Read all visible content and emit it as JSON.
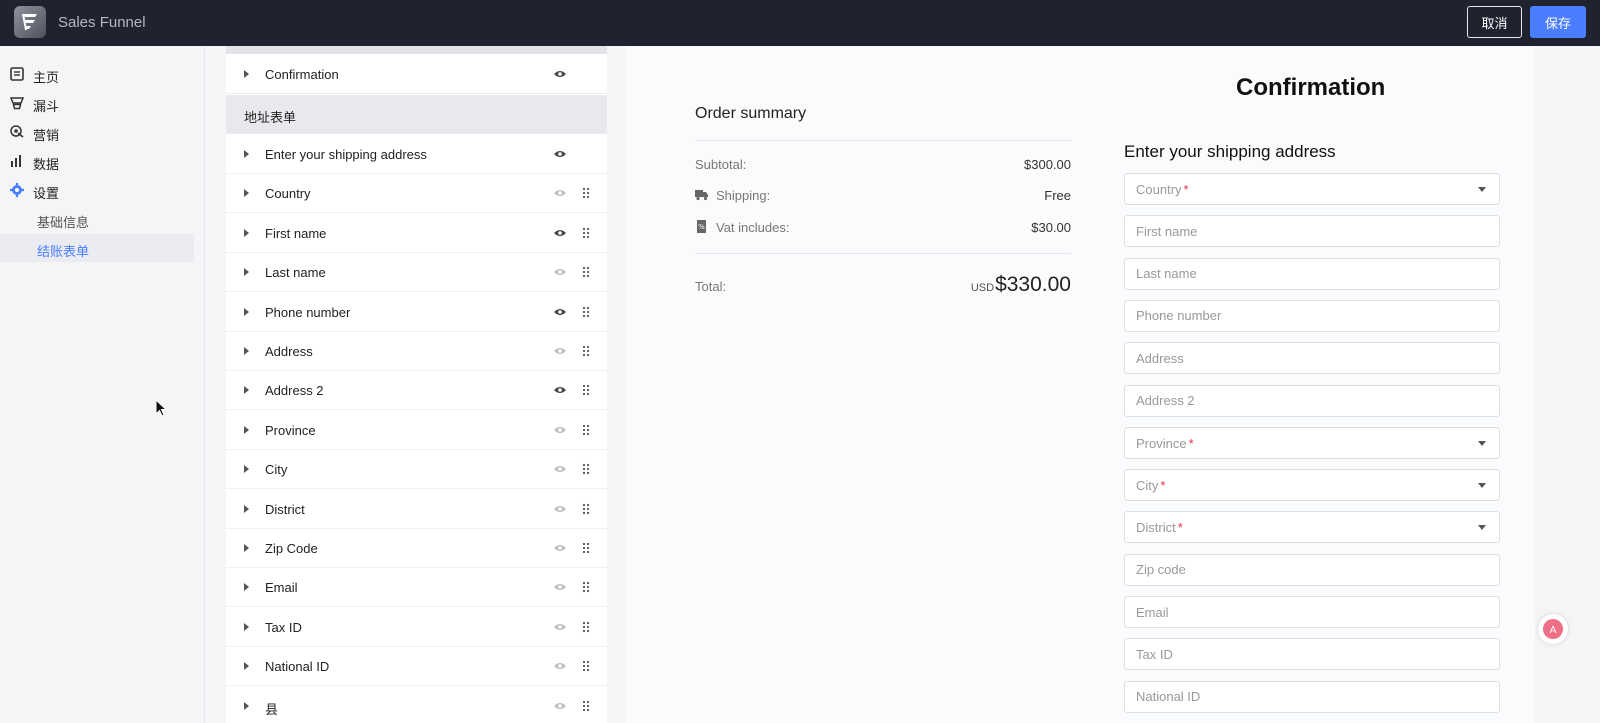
{
  "header": {
    "app_title": "Sales Funnel",
    "cancel_label": "取消",
    "save_label": "保存"
  },
  "sidebar": {
    "items": [
      {
        "label": "主页",
        "icon": "list-icon"
      },
      {
        "label": "漏斗",
        "icon": "funnel-icon"
      },
      {
        "label": "营销",
        "icon": "marketing-icon"
      },
      {
        "label": "数据",
        "icon": "chart-icon"
      },
      {
        "label": "设置",
        "icon": "gear-icon"
      }
    ],
    "sub_items": [
      {
        "label": "基础信息"
      },
      {
        "label": "结账表单",
        "active": true
      }
    ]
  },
  "field_list": {
    "top_row": {
      "label": "Confirmation",
      "visible": true
    },
    "section_title": "地址表单",
    "rows": [
      {
        "label": "Enter your shipping address",
        "visible": true,
        "draggable": false
      },
      {
        "label": "Country",
        "visible": false,
        "draggable": true
      },
      {
        "label": "First name",
        "visible": true,
        "draggable": true
      },
      {
        "label": "Last name",
        "visible": false,
        "draggable": true
      },
      {
        "label": "Phone number",
        "visible": true,
        "draggable": true
      },
      {
        "label": "Address",
        "visible": false,
        "draggable": true
      },
      {
        "label": "Address 2",
        "visible": true,
        "draggable": true
      },
      {
        "label": "Province",
        "visible": false,
        "draggable": true
      },
      {
        "label": "City",
        "visible": false,
        "draggable": true
      },
      {
        "label": "District",
        "visible": false,
        "draggable": true
      },
      {
        "label": "Zip Code",
        "visible": false,
        "draggable": true
      },
      {
        "label": "Email",
        "visible": false,
        "draggable": true
      },
      {
        "label": "Tax ID",
        "visible": false,
        "draggable": true
      },
      {
        "label": "National ID",
        "visible": false,
        "draggable": true
      },
      {
        "label": "县",
        "visible": false,
        "draggable": true
      }
    ]
  },
  "preview": {
    "page_title": "Confirmation",
    "order_summary": {
      "title": "Order summary",
      "subtotal_label": "Subtotal:",
      "subtotal_value": "$300.00",
      "shipping_label": "Shipping:",
      "shipping_value": "Free",
      "vat_label": "Vat includes:",
      "vat_value": "$30.00",
      "total_label": "Total:",
      "total_currency": "USD",
      "total_value": "$330.00"
    },
    "shipping": {
      "title": "Enter your shipping address",
      "fields": [
        {
          "placeholder": "Country",
          "required": true,
          "select": true
        },
        {
          "placeholder": "First name",
          "required": false,
          "select": false
        },
        {
          "placeholder": "Last name",
          "required": false,
          "select": false
        },
        {
          "placeholder": "Phone number",
          "required": false,
          "select": false
        },
        {
          "placeholder": "Address",
          "required": false,
          "select": false
        },
        {
          "placeholder": "Address 2",
          "required": false,
          "select": false
        },
        {
          "placeholder": "Province",
          "required": true,
          "select": true
        },
        {
          "placeholder": "City",
          "required": true,
          "select": true
        },
        {
          "placeholder": "District",
          "required": true,
          "select": true
        },
        {
          "placeholder": "Zip code",
          "required": false,
          "select": false
        },
        {
          "placeholder": "Email",
          "required": false,
          "select": false
        },
        {
          "placeholder": "Tax ID",
          "required": false,
          "select": false
        },
        {
          "placeholder": "National ID",
          "required": false,
          "select": false
        }
      ]
    }
  },
  "colors": {
    "topbar": "#1f2330",
    "accent": "#4a7dff",
    "required": "#e5334a"
  }
}
